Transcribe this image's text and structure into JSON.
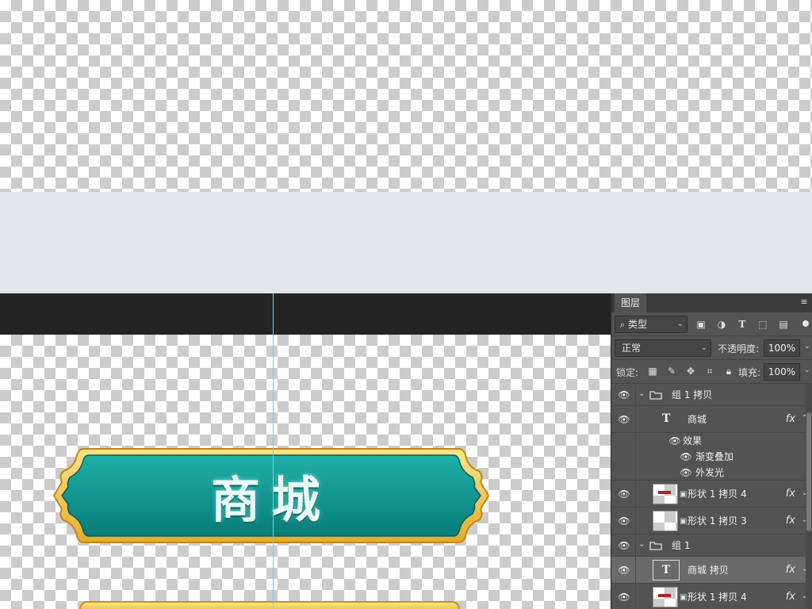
{
  "panel": {
    "tab_label": "图层",
    "menu_icon": "≡"
  },
  "filter": {
    "kind_label": "类型",
    "icons": [
      "image-filter-icon",
      "adjustment-filter-icon",
      "type-filter-icon",
      "shape-filter-icon",
      "smart-object-filter-icon"
    ]
  },
  "blend": {
    "mode": "正常",
    "opacity_label": "不透明度:",
    "opacity_value": "100%"
  },
  "lock": {
    "label": "锁定:",
    "fill_label": "填充:",
    "fill_value": "100%"
  },
  "canvas": {
    "button_text": "商城"
  },
  "layers": [
    {
      "name": "组 1 拷贝",
      "kind": "group",
      "expanded": true
    },
    {
      "name": "商城",
      "kind": "text",
      "fx": "fx"
    },
    {
      "name": "效果",
      "kind": "effects-header"
    },
    {
      "name": "渐变叠加",
      "kind": "effect"
    },
    {
      "name": "外发光",
      "kind": "effect"
    },
    {
      "name": "形状 1 拷贝 4",
      "kind": "shape",
      "fx": "fx"
    },
    {
      "name": "形状 1 拷贝 3",
      "kind": "shape",
      "fx": "fx"
    },
    {
      "name": "组 1",
      "kind": "group",
      "expanded": true
    },
    {
      "name": "商城 拷贝",
      "kind": "text",
      "fx": "fx",
      "selected": true
    },
    {
      "name": "形状 1 拷贝 4",
      "kind": "shape",
      "fx": "fx"
    }
  ],
  "colors": {
    "button_teal": "#0e9d95",
    "button_gold": "#f2c444",
    "panel_bg": "#535353",
    "guide": "#5fd7e6"
  }
}
